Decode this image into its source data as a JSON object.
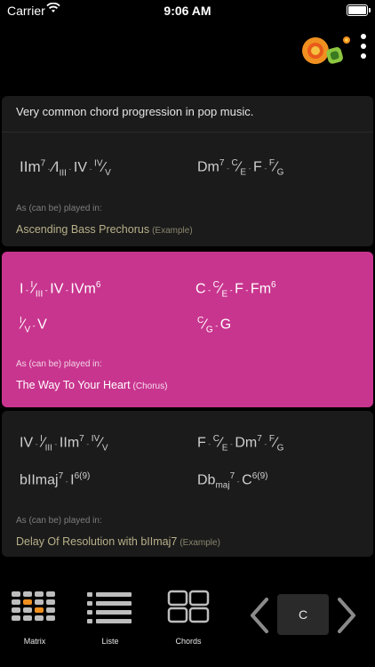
{
  "status": {
    "carrier": "Carrier",
    "time": "9:06 AM"
  },
  "description": "Very common chord progression in pop music.",
  "played_in_label": "As (can be) played in:",
  "progressions": [
    {
      "song": "Ascending Bass Prechorus",
      "section": "(Example)"
    },
    {
      "song": "The Way To Your Heart",
      "section": "(Chorus)"
    },
    {
      "song": "Delay Of Resolution with bIImaj7",
      "section": "(Example)"
    }
  ],
  "tabs": {
    "matrix": "Matrix",
    "liste": "Liste",
    "chords": "Chords"
  },
  "key": "C",
  "colors": {
    "highlight": "#c8358e",
    "card": "#1b1b1b",
    "song_text": "#b8b08a"
  }
}
